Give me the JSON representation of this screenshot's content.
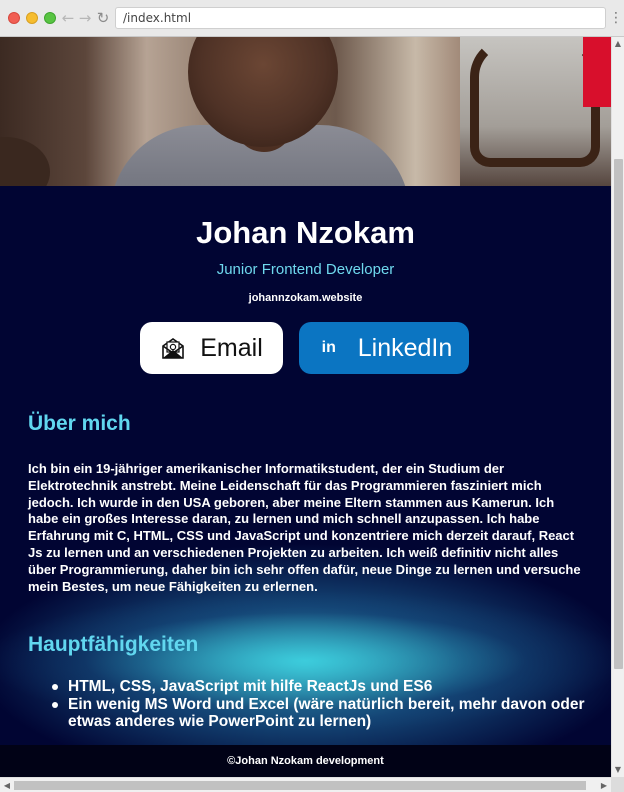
{
  "browser": {
    "url": "/index.html",
    "back_glyph": "←",
    "forward_glyph": "→",
    "reload_glyph": "↻",
    "menu_glyph": "⋮"
  },
  "hero": {
    "image": "portrait-photo"
  },
  "profile": {
    "name": "Johan Nzokam",
    "role": "Junior Frontend Developer",
    "website": "johannzokam.website"
  },
  "buttons": {
    "email_label": "Email",
    "email_icon": "envelope-icon",
    "linkedin_label": "LinkedIn",
    "linkedin_glyph": "in"
  },
  "about": {
    "heading": "Über mich",
    "text": "Ich bin ein 19-jähriger amerikanischer Informatikstudent, der ein Studium der Elektrotechnik anstrebt. Meine Leidenschaft für das Programmieren fasziniert mich jedoch. Ich wurde in den USA geboren, aber meine Eltern stammen aus Kamerun. Ich habe ein großes Interesse daran, zu lernen und mich schnell anzupassen. Ich habe Erfahrung mit C, HTML, CSS und JavaScript und konzentriere mich derzeit darauf, React Js zu lernen und an verschiedenen Projekten zu arbeiten. Ich weiß definitiv nicht alles über Programmierung, daher bin ich sehr offen dafür, neue Dinge zu lernen und versuche mein Bestes, um neue Fähigkeiten zu erlernen."
  },
  "skills": {
    "heading": "Hauptfähigkeiten",
    "items": [
      "HTML, CSS, JavaScript mit hilfe ReactJs und ES6",
      "Ein wenig MS Word und Excel (wäre natürlich bereit, mehr davon oder etwas anderes wie PowerPoint zu lernen)"
    ]
  },
  "footer": {
    "text": "©Johan Nzokam development"
  },
  "colors": {
    "background": "#010533",
    "accent": "#61d7ef",
    "linkedin": "#0b75c2"
  }
}
